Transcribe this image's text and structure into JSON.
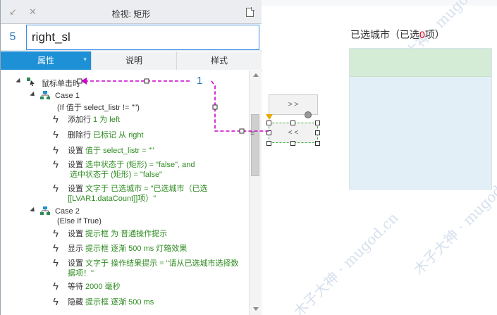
{
  "inspector": {
    "title": "检视: 矩形",
    "page_number": "5",
    "widget_name": "right_sl",
    "tabs": [
      {
        "label": "属性",
        "active": true,
        "modified": "*"
      },
      {
        "label": "说明",
        "active": false
      },
      {
        "label": "样式",
        "active": false
      }
    ]
  },
  "event": {
    "label": "鼠标单击时",
    "link_number": "1"
  },
  "case1": {
    "title": "Case 1",
    "condition": "(If 值于 select_listr != \"\")",
    "actions": [
      {
        "verb": "添加行",
        "detail": " 1 为 left",
        "detail2": ""
      },
      {
        "verb": "删除行",
        "detail": " 已标记 从 right",
        "detail2": ""
      },
      {
        "verb": "设置",
        "detail": " 值于 select_listr = \"\"",
        "detail2": ""
      },
      {
        "verb": "设置",
        "detail": " 选中状态于 (矩形) = \"false\", and",
        "detail2": "选中状态于 (矩形) = \"false\""
      },
      {
        "verb": "设置",
        "detail": " 文字于 已选城市 = \"已选城市（已选",
        "detail2": "[[LVAR1.dataCount]]项）\""
      }
    ]
  },
  "case2": {
    "title": "Case 2",
    "condition": "(Else If True)",
    "actions": [
      {
        "verb": "设置",
        "detail": " 提示框 为 普通操作提示",
        "detail2": ""
      },
      {
        "verb": "显示",
        "detail": " 提示框 逐渐 500 ms 灯箱效果",
        "detail2": ""
      },
      {
        "verb": "设置",
        "detail": " 文字于 操作结果提示 = \"请从已选城市选择数",
        "detail2": "据项！\""
      },
      {
        "verb": "等待",
        "detail": " 2000 毫秒",
        "detail2": ""
      },
      {
        "verb": "隐藏",
        "detail": " 提示框 逐渐 500 ms",
        "detail2": ""
      }
    ]
  },
  "canvas": {
    "city_title_prefix": "已选城市（已选",
    "city_count": "0",
    "city_title_suffix": "项）",
    "btn_right_label": "> >",
    "btn_left_label": "< <",
    "watermark": "木子大神 · mugod.cn"
  },
  "colors": {
    "accent": "#1e90d6",
    "action_detail": "#2e8b20",
    "link": "#cc00cc",
    "count_red": "#e60012"
  }
}
